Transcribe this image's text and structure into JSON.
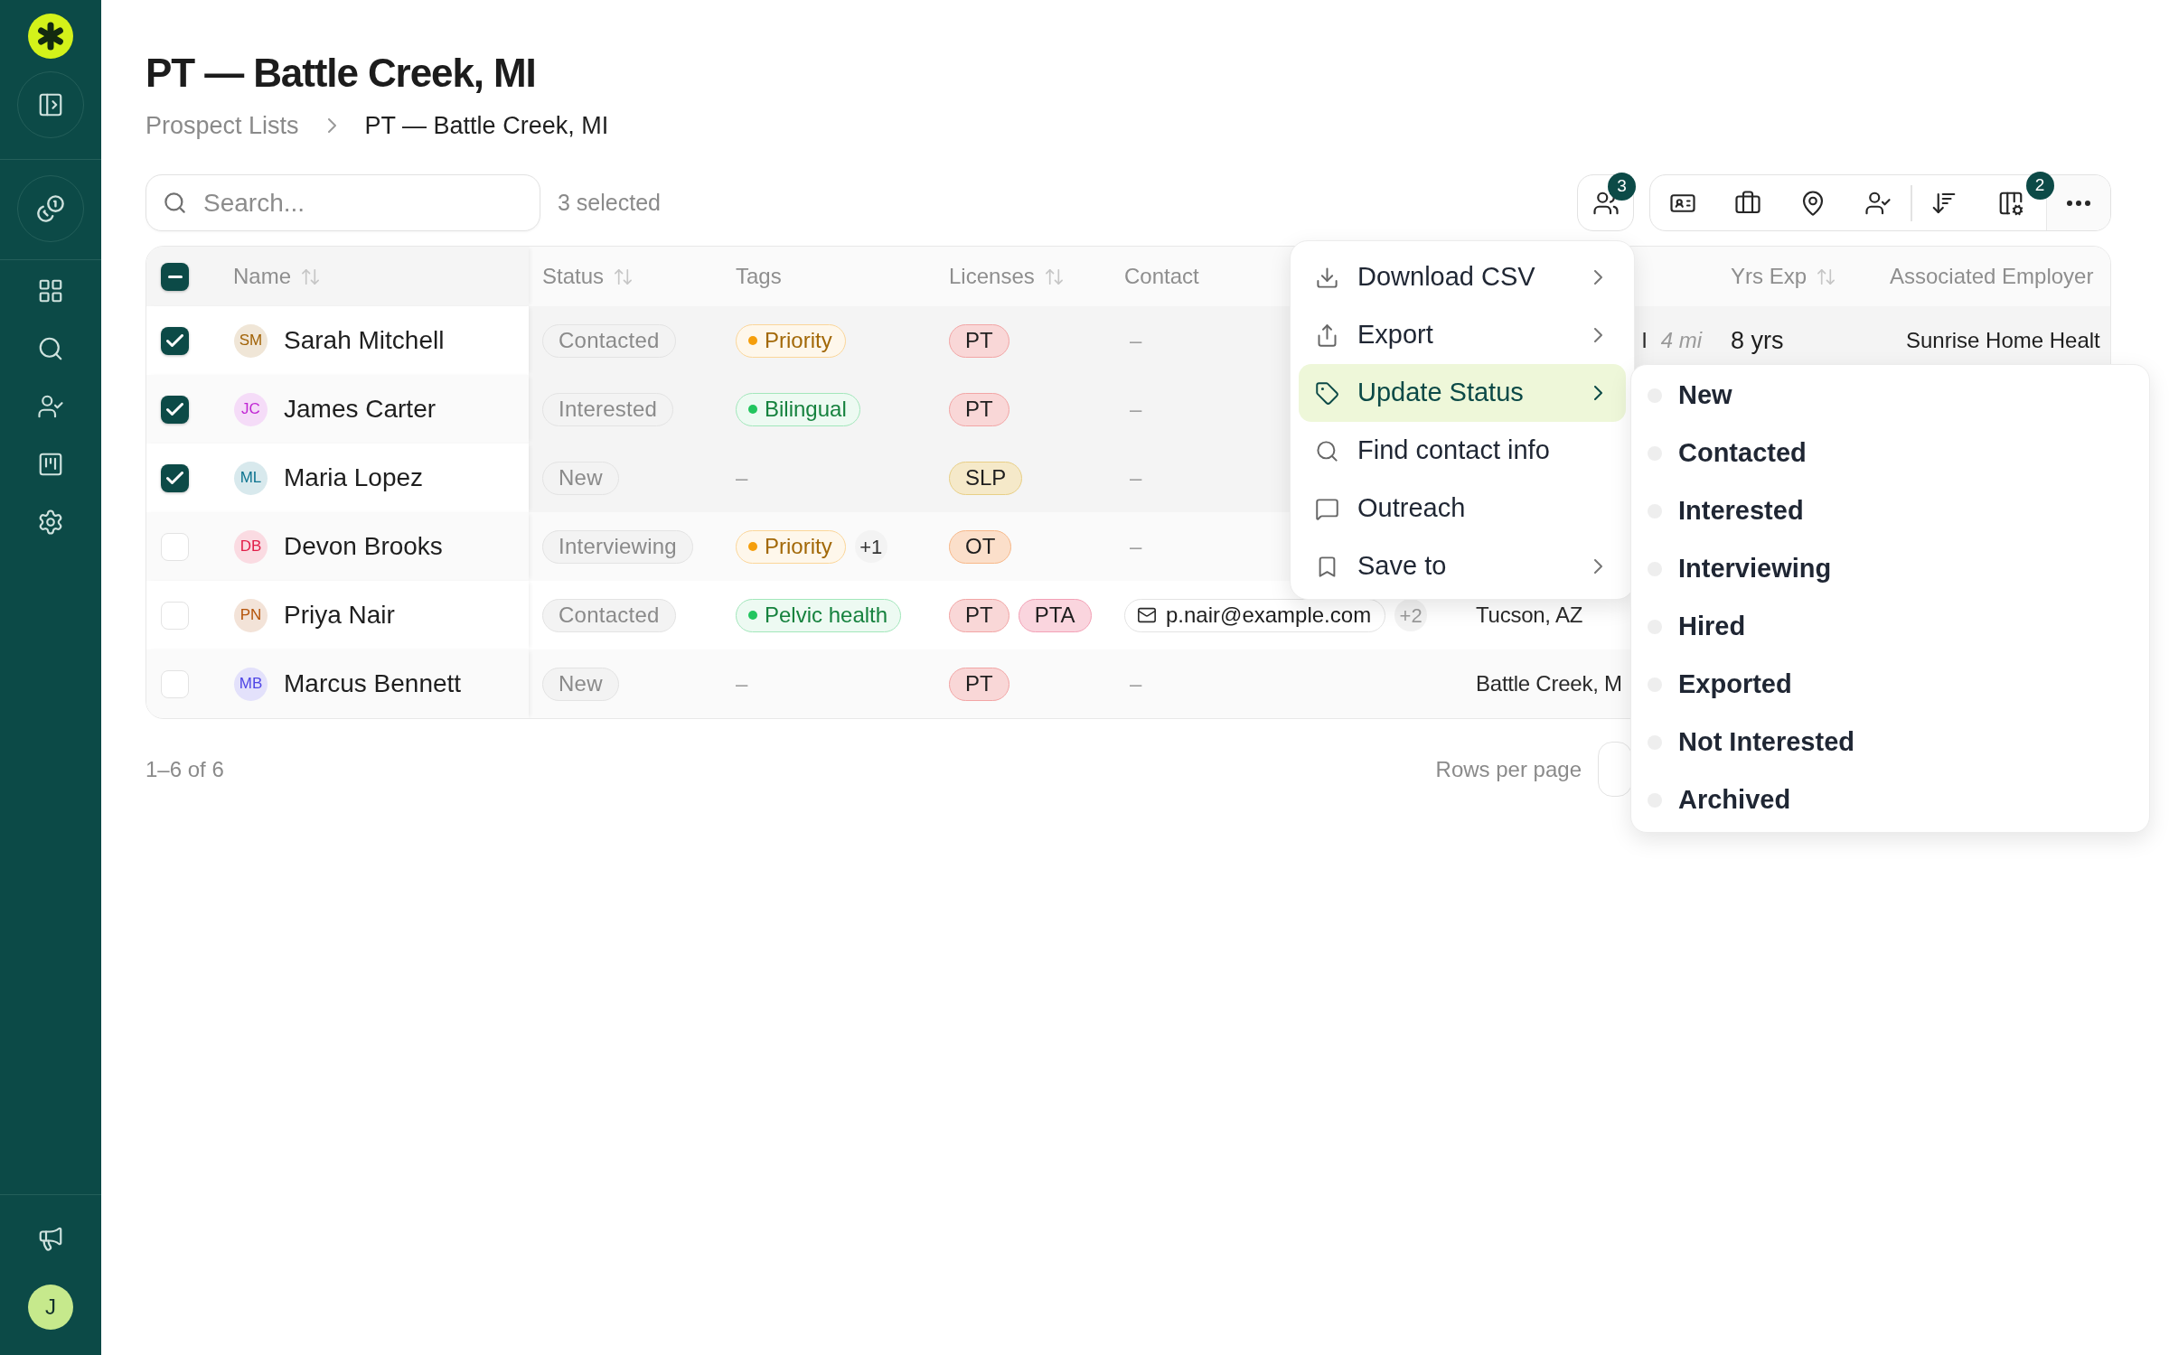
{
  "sidebar": {
    "user_initial": "J"
  },
  "page": {
    "title": "PT — Battle Creek, MI",
    "breadcrumb": [
      {
        "label": "Prospect Lists",
        "current": false
      },
      {
        "label": "PT — Battle Creek, MI",
        "current": true
      }
    ]
  },
  "toolbar": {
    "search": {
      "placeholder": "Search..."
    },
    "selection_count": "3 selected",
    "contacts_badge": "3",
    "columns_badge": "2"
  },
  "table": {
    "select_all": {
      "checked": true,
      "indeterminate": true
    },
    "columns": [
      {
        "label": "Name",
        "sortable": true
      },
      {
        "label": "Status",
        "sortable": true
      },
      {
        "label": "Tags",
        "sortable": false
      },
      {
        "label": "Licenses",
        "sortable": true
      },
      {
        "label": "Contact",
        "sortable": false
      },
      {
        "label": "Yrs Exp",
        "sortable": true
      },
      {
        "label": "Associated Employer",
        "sortable": false
      }
    ],
    "rows": [
      {
        "selected": true,
        "avatar": {
          "initials": "SM",
          "color": "#a16207"
        },
        "name": "Sarah Mitchell",
        "status": "Contacted",
        "tags": [
          {
            "label": "Priority",
            "color": "#f59e0b"
          }
        ],
        "licenses": [
          {
            "label": "PT",
            "color": "#f2a5a5"
          }
        ],
        "contact": {
          "kind": "empty",
          "value": "–"
        },
        "location": {
          "text": "I",
          "distance": "4 mi"
        },
        "yrs_exp": "8 yrs",
        "employer": "Sunrise Home Healt"
      },
      {
        "selected": true,
        "avatar": {
          "initials": "JC",
          "color": "#c026d3"
        },
        "name": "James Carter",
        "status": "Interested",
        "tags": [
          {
            "label": "Bilingual",
            "color": "#22c55e"
          }
        ],
        "licenses": [
          {
            "label": "PT",
            "color": "#f2a5a5"
          }
        ],
        "contact": {
          "kind": "empty",
          "value": "–"
        }
      },
      {
        "selected": true,
        "avatar": {
          "initials": "ML",
          "color": "#0e7490"
        },
        "name": "Maria Lopez",
        "status": "New",
        "tags_empty": "–",
        "licenses": [
          {
            "label": "SLP",
            "color": "#e8cf86"
          }
        ],
        "contact": {
          "kind": "empty",
          "value": "–"
        }
      },
      {
        "selected": false,
        "avatar": {
          "initials": "DB",
          "color": "#e11d48"
        },
        "name": "Devon Brooks",
        "status": "Interviewing",
        "tags": [
          {
            "label": "Priority",
            "color": "#f59e0b"
          }
        ],
        "tags_more": "+1",
        "licenses": [
          {
            "label": "OT",
            "color": "#f7b889"
          }
        ],
        "contact": {
          "kind": "empty",
          "value": "–"
        }
      },
      {
        "selected": false,
        "avatar": {
          "initials": "PN",
          "color": "#b45309"
        },
        "name": "Priya Nair",
        "status": "Contacted",
        "tags": [
          {
            "label": "Pelvic health",
            "color": "#22c55e"
          }
        ],
        "licenses": [
          {
            "label": "PT",
            "color": "#f2a5a5"
          },
          {
            "label": "PTA",
            "color": "#f3a1b6"
          }
        ],
        "contact": {
          "kind": "email",
          "value": "p.nair@example.com",
          "more": "+2"
        },
        "location": {
          "text": "Tucson, AZ"
        }
      },
      {
        "selected": false,
        "avatar": {
          "initials": "MB",
          "color": "#4f46e5"
        },
        "name": "Marcus Bennett",
        "status": "New",
        "tags_empty": "–",
        "licenses": [
          {
            "label": "PT",
            "color": "#f2a5a5"
          }
        ],
        "contact": {
          "kind": "empty",
          "value": "–"
        },
        "location": {
          "text": "Battle Creek, M"
        }
      }
    ]
  },
  "pagination": {
    "range": "1–6 of 6",
    "rows_per_page_label": "Rows per page"
  },
  "actions_menu": {
    "items": [
      {
        "label": "Download CSV",
        "has_submenu": true,
        "selected": false
      },
      {
        "label": "Export",
        "has_submenu": true,
        "selected": false
      },
      {
        "label": "Update Status",
        "has_submenu": true,
        "selected": true
      },
      {
        "label": "Find contact info",
        "has_submenu": false,
        "selected": false
      },
      {
        "label": "Outreach",
        "has_submenu": false,
        "selected": false
      },
      {
        "label": "Save to",
        "has_submenu": true,
        "selected": false
      }
    ]
  },
  "status_submenu": {
    "items": [
      {
        "label": "New"
      },
      {
        "label": "Contacted"
      },
      {
        "label": "Interested"
      },
      {
        "label": "Interviewing"
      },
      {
        "label": "Hired"
      },
      {
        "label": "Exported"
      },
      {
        "label": "Not Interested"
      },
      {
        "label": "Archived"
      }
    ]
  }
}
